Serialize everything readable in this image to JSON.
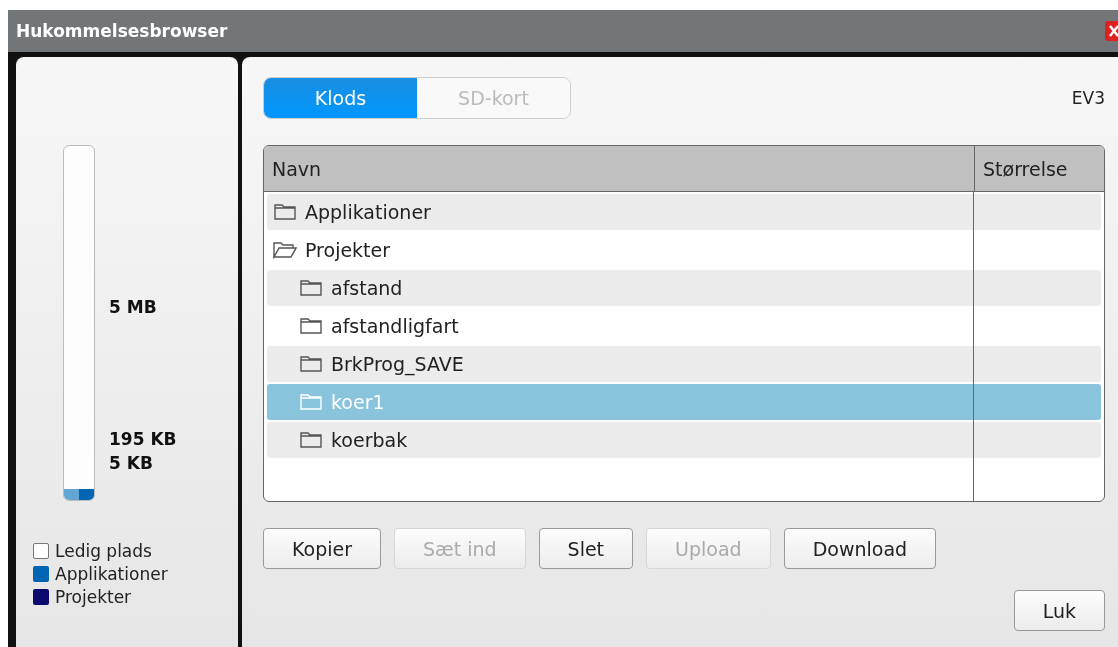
{
  "window": {
    "title": "Hukommelsesbrowser"
  },
  "memory": {
    "level": 0.03,
    "labels": [
      "5 MB",
      "195 KB",
      "5 KB"
    ],
    "legend": [
      {
        "label": "Ledig plads",
        "color": "#ffffff"
      },
      {
        "label": "Applikationer",
        "color": "#0066b3"
      },
      {
        "label": "Projekter",
        "color": "#0c0a6e"
      }
    ]
  },
  "tabs": [
    {
      "label": "Klods",
      "selected": true
    },
    {
      "label": "SD-kort",
      "selected": false
    }
  ],
  "device": "EV3",
  "table": {
    "columns": [
      "Navn",
      "Størrelse"
    ],
    "rows": [
      {
        "name": "Applikationer",
        "expanded": false,
        "selected": false
      },
      {
        "name": "Projekter",
        "expanded": true,
        "selected": false,
        "children": [
          {
            "name": "afstand",
            "expanded": false,
            "selected": false
          },
          {
            "name": "afstandligfart",
            "expanded": false,
            "selected": false
          },
          {
            "name": "BrkProg_SAVE",
            "expanded": false,
            "selected": false
          },
          {
            "name": "koer1",
            "expanded": false,
            "selected": true
          },
          {
            "name": "koerbak",
            "expanded": false,
            "selected": false
          }
        ]
      }
    ]
  },
  "buttons": [
    {
      "label": "Kopier",
      "disabled": false
    },
    {
      "label": "Sæt ind",
      "disabled": true
    },
    {
      "label": "Slet",
      "disabled": false
    },
    {
      "label": "Upload",
      "disabled": true
    },
    {
      "label": "Download",
      "disabled": false
    }
  ],
  "close_button": "Luk"
}
